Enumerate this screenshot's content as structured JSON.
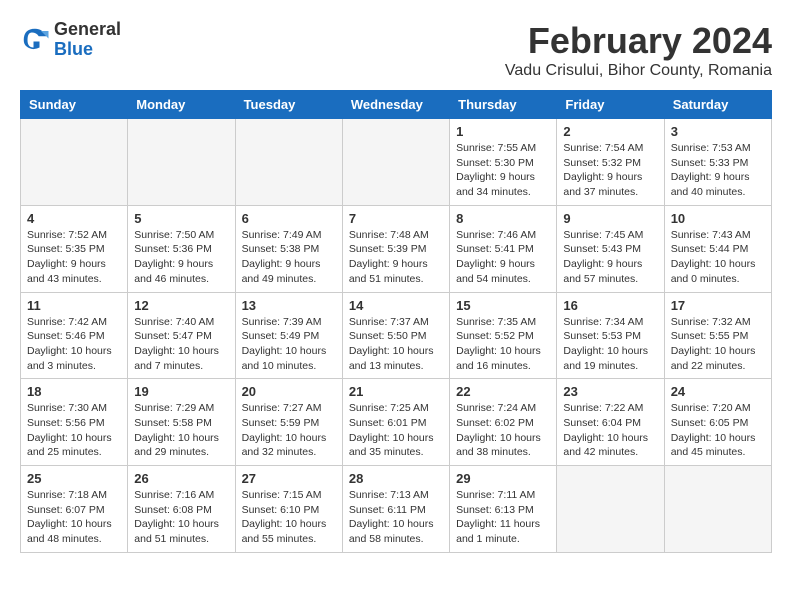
{
  "logo": {
    "general": "General",
    "blue": "Blue"
  },
  "title": "February 2024",
  "subtitle": "Vadu Crisului, Bihor County, Romania",
  "days_of_week": [
    "Sunday",
    "Monday",
    "Tuesday",
    "Wednesday",
    "Thursday",
    "Friday",
    "Saturday"
  ],
  "weeks": [
    [
      {
        "day": "",
        "info": ""
      },
      {
        "day": "",
        "info": ""
      },
      {
        "day": "",
        "info": ""
      },
      {
        "day": "",
        "info": ""
      },
      {
        "day": "1",
        "info": "Sunrise: 7:55 AM\nSunset: 5:30 PM\nDaylight: 9 hours\nand 34 minutes."
      },
      {
        "day": "2",
        "info": "Sunrise: 7:54 AM\nSunset: 5:32 PM\nDaylight: 9 hours\nand 37 minutes."
      },
      {
        "day": "3",
        "info": "Sunrise: 7:53 AM\nSunset: 5:33 PM\nDaylight: 9 hours\nand 40 minutes."
      }
    ],
    [
      {
        "day": "4",
        "info": "Sunrise: 7:52 AM\nSunset: 5:35 PM\nDaylight: 9 hours\nand 43 minutes."
      },
      {
        "day": "5",
        "info": "Sunrise: 7:50 AM\nSunset: 5:36 PM\nDaylight: 9 hours\nand 46 minutes."
      },
      {
        "day": "6",
        "info": "Sunrise: 7:49 AM\nSunset: 5:38 PM\nDaylight: 9 hours\nand 49 minutes."
      },
      {
        "day": "7",
        "info": "Sunrise: 7:48 AM\nSunset: 5:39 PM\nDaylight: 9 hours\nand 51 minutes."
      },
      {
        "day": "8",
        "info": "Sunrise: 7:46 AM\nSunset: 5:41 PM\nDaylight: 9 hours\nand 54 minutes."
      },
      {
        "day": "9",
        "info": "Sunrise: 7:45 AM\nSunset: 5:43 PM\nDaylight: 9 hours\nand 57 minutes."
      },
      {
        "day": "10",
        "info": "Sunrise: 7:43 AM\nSunset: 5:44 PM\nDaylight: 10 hours\nand 0 minutes."
      }
    ],
    [
      {
        "day": "11",
        "info": "Sunrise: 7:42 AM\nSunset: 5:46 PM\nDaylight: 10 hours\nand 3 minutes."
      },
      {
        "day": "12",
        "info": "Sunrise: 7:40 AM\nSunset: 5:47 PM\nDaylight: 10 hours\nand 7 minutes."
      },
      {
        "day": "13",
        "info": "Sunrise: 7:39 AM\nSunset: 5:49 PM\nDaylight: 10 hours\nand 10 minutes."
      },
      {
        "day": "14",
        "info": "Sunrise: 7:37 AM\nSunset: 5:50 PM\nDaylight: 10 hours\nand 13 minutes."
      },
      {
        "day": "15",
        "info": "Sunrise: 7:35 AM\nSunset: 5:52 PM\nDaylight: 10 hours\nand 16 minutes."
      },
      {
        "day": "16",
        "info": "Sunrise: 7:34 AM\nSunset: 5:53 PM\nDaylight: 10 hours\nand 19 minutes."
      },
      {
        "day": "17",
        "info": "Sunrise: 7:32 AM\nSunset: 5:55 PM\nDaylight: 10 hours\nand 22 minutes."
      }
    ],
    [
      {
        "day": "18",
        "info": "Sunrise: 7:30 AM\nSunset: 5:56 PM\nDaylight: 10 hours\nand 25 minutes."
      },
      {
        "day": "19",
        "info": "Sunrise: 7:29 AM\nSunset: 5:58 PM\nDaylight: 10 hours\nand 29 minutes."
      },
      {
        "day": "20",
        "info": "Sunrise: 7:27 AM\nSunset: 5:59 PM\nDaylight: 10 hours\nand 32 minutes."
      },
      {
        "day": "21",
        "info": "Sunrise: 7:25 AM\nSunset: 6:01 PM\nDaylight: 10 hours\nand 35 minutes."
      },
      {
        "day": "22",
        "info": "Sunrise: 7:24 AM\nSunset: 6:02 PM\nDaylight: 10 hours\nand 38 minutes."
      },
      {
        "day": "23",
        "info": "Sunrise: 7:22 AM\nSunset: 6:04 PM\nDaylight: 10 hours\nand 42 minutes."
      },
      {
        "day": "24",
        "info": "Sunrise: 7:20 AM\nSunset: 6:05 PM\nDaylight: 10 hours\nand 45 minutes."
      }
    ],
    [
      {
        "day": "25",
        "info": "Sunrise: 7:18 AM\nSunset: 6:07 PM\nDaylight: 10 hours\nand 48 minutes."
      },
      {
        "day": "26",
        "info": "Sunrise: 7:16 AM\nSunset: 6:08 PM\nDaylight: 10 hours\nand 51 minutes."
      },
      {
        "day": "27",
        "info": "Sunrise: 7:15 AM\nSunset: 6:10 PM\nDaylight: 10 hours\nand 55 minutes."
      },
      {
        "day": "28",
        "info": "Sunrise: 7:13 AM\nSunset: 6:11 PM\nDaylight: 10 hours\nand 58 minutes."
      },
      {
        "day": "29",
        "info": "Sunrise: 7:11 AM\nSunset: 6:13 PM\nDaylight: 11 hours\nand 1 minute."
      },
      {
        "day": "",
        "info": ""
      },
      {
        "day": "",
        "info": ""
      }
    ]
  ]
}
